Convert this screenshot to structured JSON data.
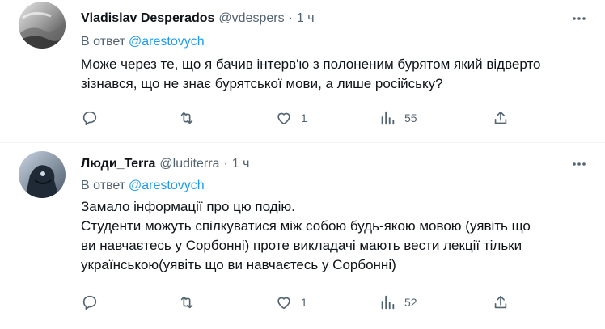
{
  "tweets": [
    {
      "display_name": "Vladislav Desperados",
      "handle": "@vdespers",
      "separator": "·",
      "time": "1 ч",
      "reply_prefix": "В ответ",
      "reply_to": "@arestovych",
      "text_lines": [
        "Може через те, що я бачив інтерв'ю з полоненим бурятом який відверто",
        "зізнався, що не знає бурятської мови, а лише російську?"
      ],
      "reply_count": "",
      "retweet_count": "",
      "like_count": "1",
      "view_count": "55"
    },
    {
      "display_name": "Люди_Terra",
      "handle": "@luditerra",
      "separator": "·",
      "time": "1 ч",
      "reply_prefix": "В ответ",
      "reply_to": "@arestovych",
      "text_lines": [
        "Замало інформації про цю подію.",
        "Студенти можуть спілкуватися між собою будь-якою мовою (уявіть що",
        "ви навчаєтесь у Сорбонні) проте викладачі мають вести лекції тільки",
        "українською(уявіть що ви навчаєтесь у Сорбонні)"
      ],
      "reply_count": "",
      "retweet_count": "",
      "like_count": "1",
      "view_count": "52"
    }
  ],
  "icons": {
    "more": "more-horizontal-icon",
    "reply": "reply-icon",
    "retweet": "retweet-icon",
    "like": "heart-icon",
    "views": "views-icon",
    "share": "share-icon"
  },
  "colors": {
    "link": "#1d9bf0",
    "secondary_text": "#536471",
    "primary_text": "#0f1419",
    "divider": "#eff3f4"
  }
}
